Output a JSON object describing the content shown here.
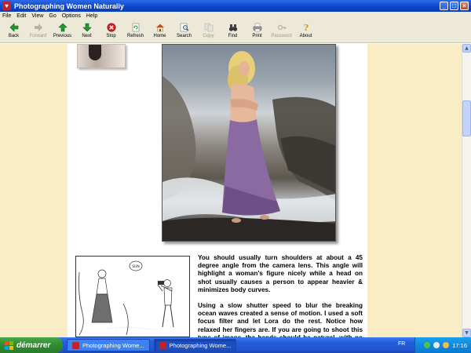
{
  "window": {
    "title": "Photographing Women Naturally"
  },
  "menu": [
    "File",
    "Edit",
    "View",
    "Go",
    "Options",
    "Help"
  ],
  "toolbar": {
    "buttons": [
      {
        "label": "Back",
        "icon": "back-arrow-icon",
        "enabled": true
      },
      {
        "label": "Forward",
        "icon": "forward-arrow-icon",
        "enabled": false
      },
      {
        "label": "Previous",
        "icon": "up-arrow-icon",
        "enabled": true
      },
      {
        "label": "Next",
        "icon": "down-arrow-icon",
        "enabled": true
      },
      {
        "label": "Stop",
        "icon": "stop-icon",
        "enabled": true
      },
      {
        "label": "Refresh",
        "icon": "refresh-icon",
        "enabled": true
      },
      {
        "label": "Home",
        "icon": "home-icon",
        "enabled": true
      },
      {
        "label": "Search",
        "icon": "search-icon",
        "enabled": true
      },
      {
        "label": "Copy",
        "icon": "copy-icon",
        "enabled": false
      },
      {
        "label": "Find",
        "icon": "binoculars-icon",
        "enabled": true
      },
      {
        "label": "Print",
        "icon": "print-icon",
        "enabled": true
      },
      {
        "label": "Password",
        "icon": "password-icon",
        "enabled": false
      },
      {
        "label": "About",
        "icon": "about-icon",
        "enabled": true
      }
    ]
  },
  "article": {
    "paragraphs": [
      "You should usually turn shoulders at about a 45 degree angle from the camera lens. This angle will highlight a woman's figure nicely while a head on shot usually causes a person to appear heavier & minimizes body curves.",
      "Using a slow shutter speed to blur the breaking ocean waves created a sense of motion. I used a soft focus filter and let Lora do the rest. Notice how relaxed her fingers are. If you are going to shoot this type of image, the hands should be natural, with no apparent concern"
    ],
    "sketch_label": "SUN"
  },
  "taskbar": {
    "start_label": "démarrer",
    "tasks": [
      "Photographing Wome...",
      "Photographing Wome..."
    ],
    "lang": "FR",
    "clock": "17:16"
  },
  "colors": {
    "page_background": "#faedc6",
    "titlebar": "#0a45c8",
    "taskbar": "#245edb",
    "start_button": "#2f8a2f"
  }
}
